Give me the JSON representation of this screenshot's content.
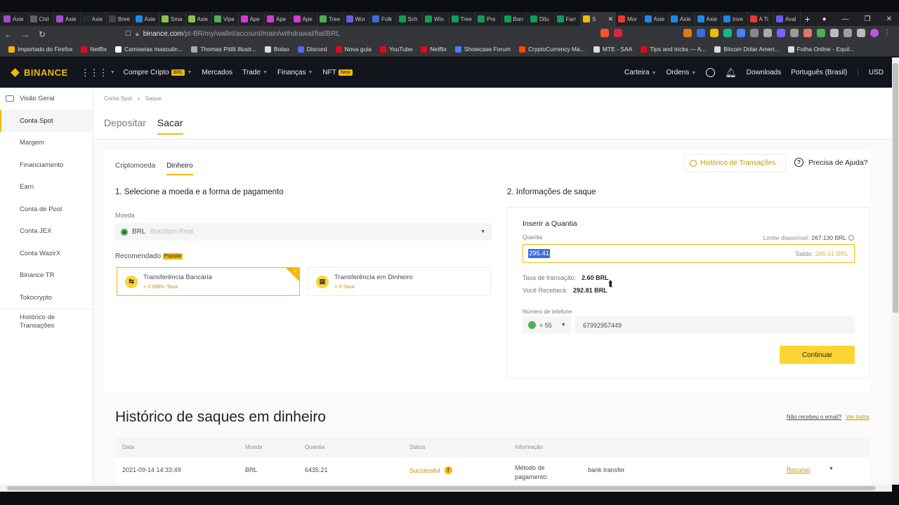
{
  "browser": {
    "tabs": [
      {
        "label": "Axie",
        "color": "#a64ad4"
      },
      {
        "label": "Chil",
        "color": "#5f6368"
      },
      {
        "label": "Axie",
        "color": "#a64ad4"
      },
      {
        "label": "Axie",
        "color": "#1e2b3c"
      },
      {
        "label": "Bree",
        "color": "#444"
      },
      {
        "label": "Axie",
        "color": "#1e88e5"
      },
      {
        "label": "Sma",
        "color": "#8bc34a"
      },
      {
        "label": "Axie",
        "color": "#8bc34a"
      },
      {
        "label": "Vipe",
        "color": "#4caf50"
      },
      {
        "label": "Ape",
        "color": "#d63ad4"
      },
      {
        "label": "Ape",
        "color": "#d63ad4"
      },
      {
        "label": "Ape",
        "color": "#d63ad4"
      },
      {
        "label": "Tree",
        "color": "#4caf50"
      },
      {
        "label": "Wor",
        "color": "#6c5ce7"
      },
      {
        "label": "Folk",
        "color": "#3b6fd6"
      },
      {
        "label": "Sch",
        "color": "#0f9d58"
      },
      {
        "label": "Win",
        "color": "#0f9d58"
      },
      {
        "label": "Tree",
        "color": "#0f9d58"
      },
      {
        "label": "Pre",
        "color": "#0f9d58"
      },
      {
        "label": "Barr",
        "color": "#0f9d58"
      },
      {
        "label": "Dilu",
        "color": "#0f9d58"
      },
      {
        "label": "Farr",
        "color": "#0f9d58"
      }
    ],
    "active_tab": {
      "label": "S",
      "color": "#f0b90b"
    },
    "tabs_after": [
      {
        "label": "Mor",
        "color": "#e53935"
      },
      {
        "label": "Axie",
        "color": "#1e88e5"
      },
      {
        "label": "Axie",
        "color": "#1e88e5"
      },
      {
        "label": "Axie",
        "color": "#1e88e5"
      },
      {
        "label": "Inve",
        "color": "#1e88e5"
      },
      {
        "label": "A Ti",
        "color": "#e53935"
      },
      {
        "label": "Aval",
        "color": "#6c5ce7"
      }
    ],
    "url_domain": "binance.com",
    "url_path": "/pt-BR/my/wallet/account/main/withdrawal/fiat/BRL",
    "bookmarks": [
      {
        "label": "Importado do Firefox",
        "color": "#f0b90b"
      },
      {
        "label": "Netflix",
        "color": "#e50914"
      },
      {
        "label": "Camisetas masculin...",
        "color": "#fff"
      },
      {
        "label": "Thomas Pitilli Illustr...",
        "color": "#aaa"
      },
      {
        "label": "Bolao",
        "color": "#ddd"
      },
      {
        "label": "Discord",
        "color": "#5865f2"
      },
      {
        "label": "Nova guia",
        "color": "#e50914"
      },
      {
        "label": "YouTube",
        "color": "#e50914"
      },
      {
        "label": "Netflix",
        "color": "#e50914"
      },
      {
        "label": "Showcase Forum",
        "color": "#4285f4"
      },
      {
        "label": "CryptoCurrency Ma...",
        "color": "#ff4500"
      },
      {
        "label": "MTE - SAA",
        "color": "#ddd"
      },
      {
        "label": "Tips and tricks — A...",
        "color": "#e50914"
      },
      {
        "label": "Bitcoin Dólar Ameri...",
        "color": "#ddd"
      },
      {
        "label": "Folha Online - Equil...",
        "color": "#ddd"
      }
    ]
  },
  "header": {
    "logo": "BINANCE",
    "nav": [
      {
        "label": "Compre Cripto",
        "badge": "BRL",
        "caret": true
      },
      {
        "label": "Mercados",
        "badge": "",
        "caret": false
      },
      {
        "label": "Trade",
        "badge": "",
        "caret": true
      },
      {
        "label": "Finanças",
        "badge": "",
        "caret": true
      },
      {
        "label": "NFT",
        "badge": "New",
        "caret": false
      }
    ],
    "right": {
      "wallet": "Carteira",
      "orders": "Ordens",
      "downloads": "Downloads",
      "language": "Português (Brasil)",
      "currency": "USD"
    }
  },
  "sidebar": {
    "items": [
      {
        "label": "Visão Geral",
        "active": false
      },
      {
        "label": "Conta Spot",
        "active": true
      },
      {
        "label": "Margem",
        "active": false
      },
      {
        "label": "Financiamento",
        "active": false
      },
      {
        "label": "Earn",
        "active": false
      },
      {
        "label": "Conta de Pool",
        "active": false
      },
      {
        "label": "Conta JEX",
        "active": false
      },
      {
        "label": "Conta WazirX",
        "active": false
      },
      {
        "label": "Binance TR",
        "active": false
      },
      {
        "label": "Tokocrypto",
        "active": false
      }
    ],
    "history_line1": "Histórico de",
    "history_line2": "Transações"
  },
  "breadcrumb": {
    "parent": "Conta Spot",
    "sep": "›",
    "current": "Saque"
  },
  "main_tabs": {
    "deposit": "Depositar",
    "withdraw": "Sacar"
  },
  "sub_tabs": {
    "crypto": "Criptomoeda",
    "cash": "Dinheiro"
  },
  "actions": {
    "history": "Histórico de Transações",
    "help": "Precisa de Ajuda?"
  },
  "step1": {
    "title": "1. Selecione a moeda e a forma de pagamento",
    "currency_label": "Moeda",
    "currency_code": "BRL",
    "currency_name": "Brazilian Real",
    "recommended": "Recomendado",
    "popular": "Popular",
    "methods": [
      {
        "title": "Transferência Bancária",
        "fee": "+ 2.6BRL Taxa",
        "icon": "⇆"
      },
      {
        "title": "Transferência em Dinheiro",
        "fee": "+ 0 Taxa",
        "icon": "▤"
      }
    ]
  },
  "step2": {
    "title": "2. Informações de saque",
    "box_title": "Inserir a Quantia",
    "amount_label": "Quantia",
    "limit_label": "Limite disponível:",
    "limit_value": "267.130 BRL",
    "amount_value": "295.41",
    "balance_label": "Saldo:",
    "balance_value": "295.41 BRL",
    "fee_label": "Taxa de transação:",
    "fee_value": "2.60 BRL",
    "receive_label": "Você Receberá:",
    "receive_value": "292.81 BRL",
    "phone_label": "Número de telefone",
    "phone_cc": "+ 55",
    "phone_number": "67992957449",
    "continue": "Continuar"
  },
  "history": {
    "title": "Histórico de saques em dinheiro",
    "no_email": "Não recebeu o email?",
    "view_all": "Ver todos",
    "columns": [
      "Data",
      "Moeda",
      "Quantia",
      "Status",
      "Informação"
    ],
    "row": {
      "date": "2021-09-14 14:33:49",
      "currency": "BRL",
      "amount": "6435.21",
      "status": "Successful",
      "info_label_1": "Método de",
      "info_label_2": "pagamento:",
      "info_value": "bank transfer",
      "action": "Recurso"
    }
  }
}
